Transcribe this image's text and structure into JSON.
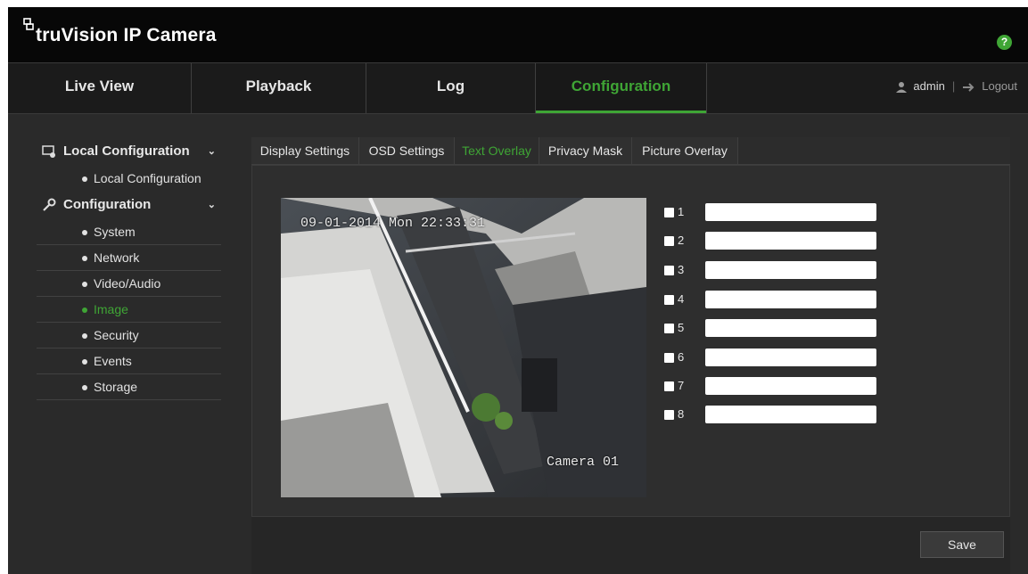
{
  "header": {
    "brand_prefix": "truVision",
    "brand_suffix": "IP Camera",
    "help_label": "?"
  },
  "nav": {
    "tabs": [
      {
        "label": "Live View"
      },
      {
        "label": "Playback"
      },
      {
        "label": "Log"
      },
      {
        "label": "Configuration"
      }
    ],
    "user": "admin",
    "logout": "Logout"
  },
  "sidebar": {
    "local": {
      "title": "Local Configuration",
      "items": [
        "Local Configuration"
      ]
    },
    "config": {
      "title": "Configuration",
      "items": [
        "System",
        "Network",
        "Video/Audio",
        "Image",
        "Security",
        "Events",
        "Storage"
      ],
      "active": "Image"
    }
  },
  "tabs": [
    "Display Settings",
    "OSD Settings",
    "Text Overlay",
    "Privacy Mask",
    "Picture Overlay"
  ],
  "active_tab": "Text Overlay",
  "video": {
    "time_text": "09-01-2014 Mon 22:33:31",
    "camera_name": "Camera 01"
  },
  "overlays": [
    {
      "num": "1",
      "value": ""
    },
    {
      "num": "2",
      "value": ""
    },
    {
      "num": "3",
      "value": ""
    },
    {
      "num": "4",
      "value": ""
    },
    {
      "num": "5",
      "value": ""
    },
    {
      "num": "6",
      "value": ""
    },
    {
      "num": "7",
      "value": ""
    },
    {
      "num": "8",
      "value": ""
    }
  ],
  "save_label": "Save",
  "colors": {
    "accent": "#3fa535"
  }
}
